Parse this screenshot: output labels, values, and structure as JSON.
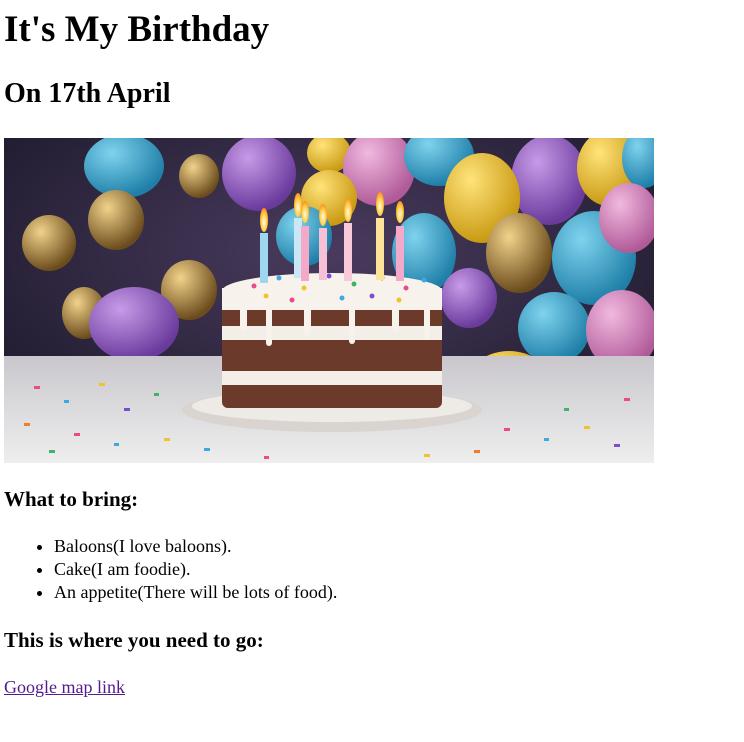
{
  "page": {
    "title": "It's My Birthday",
    "date_heading": "On 17th April",
    "image_icon": "birthday-cake-image",
    "bring_heading": "What to bring:",
    "bring_items": [
      "Baloons(I love baloons).",
      "Cake(I am foodie).",
      "An appetite(There will be lots of food)."
    ],
    "where_heading": "This is where you need to go:",
    "map_link_text": "Google map link"
  },
  "colors": {
    "link_visited": "#551a8b",
    "text": "#000000",
    "background": "#ffffff"
  }
}
